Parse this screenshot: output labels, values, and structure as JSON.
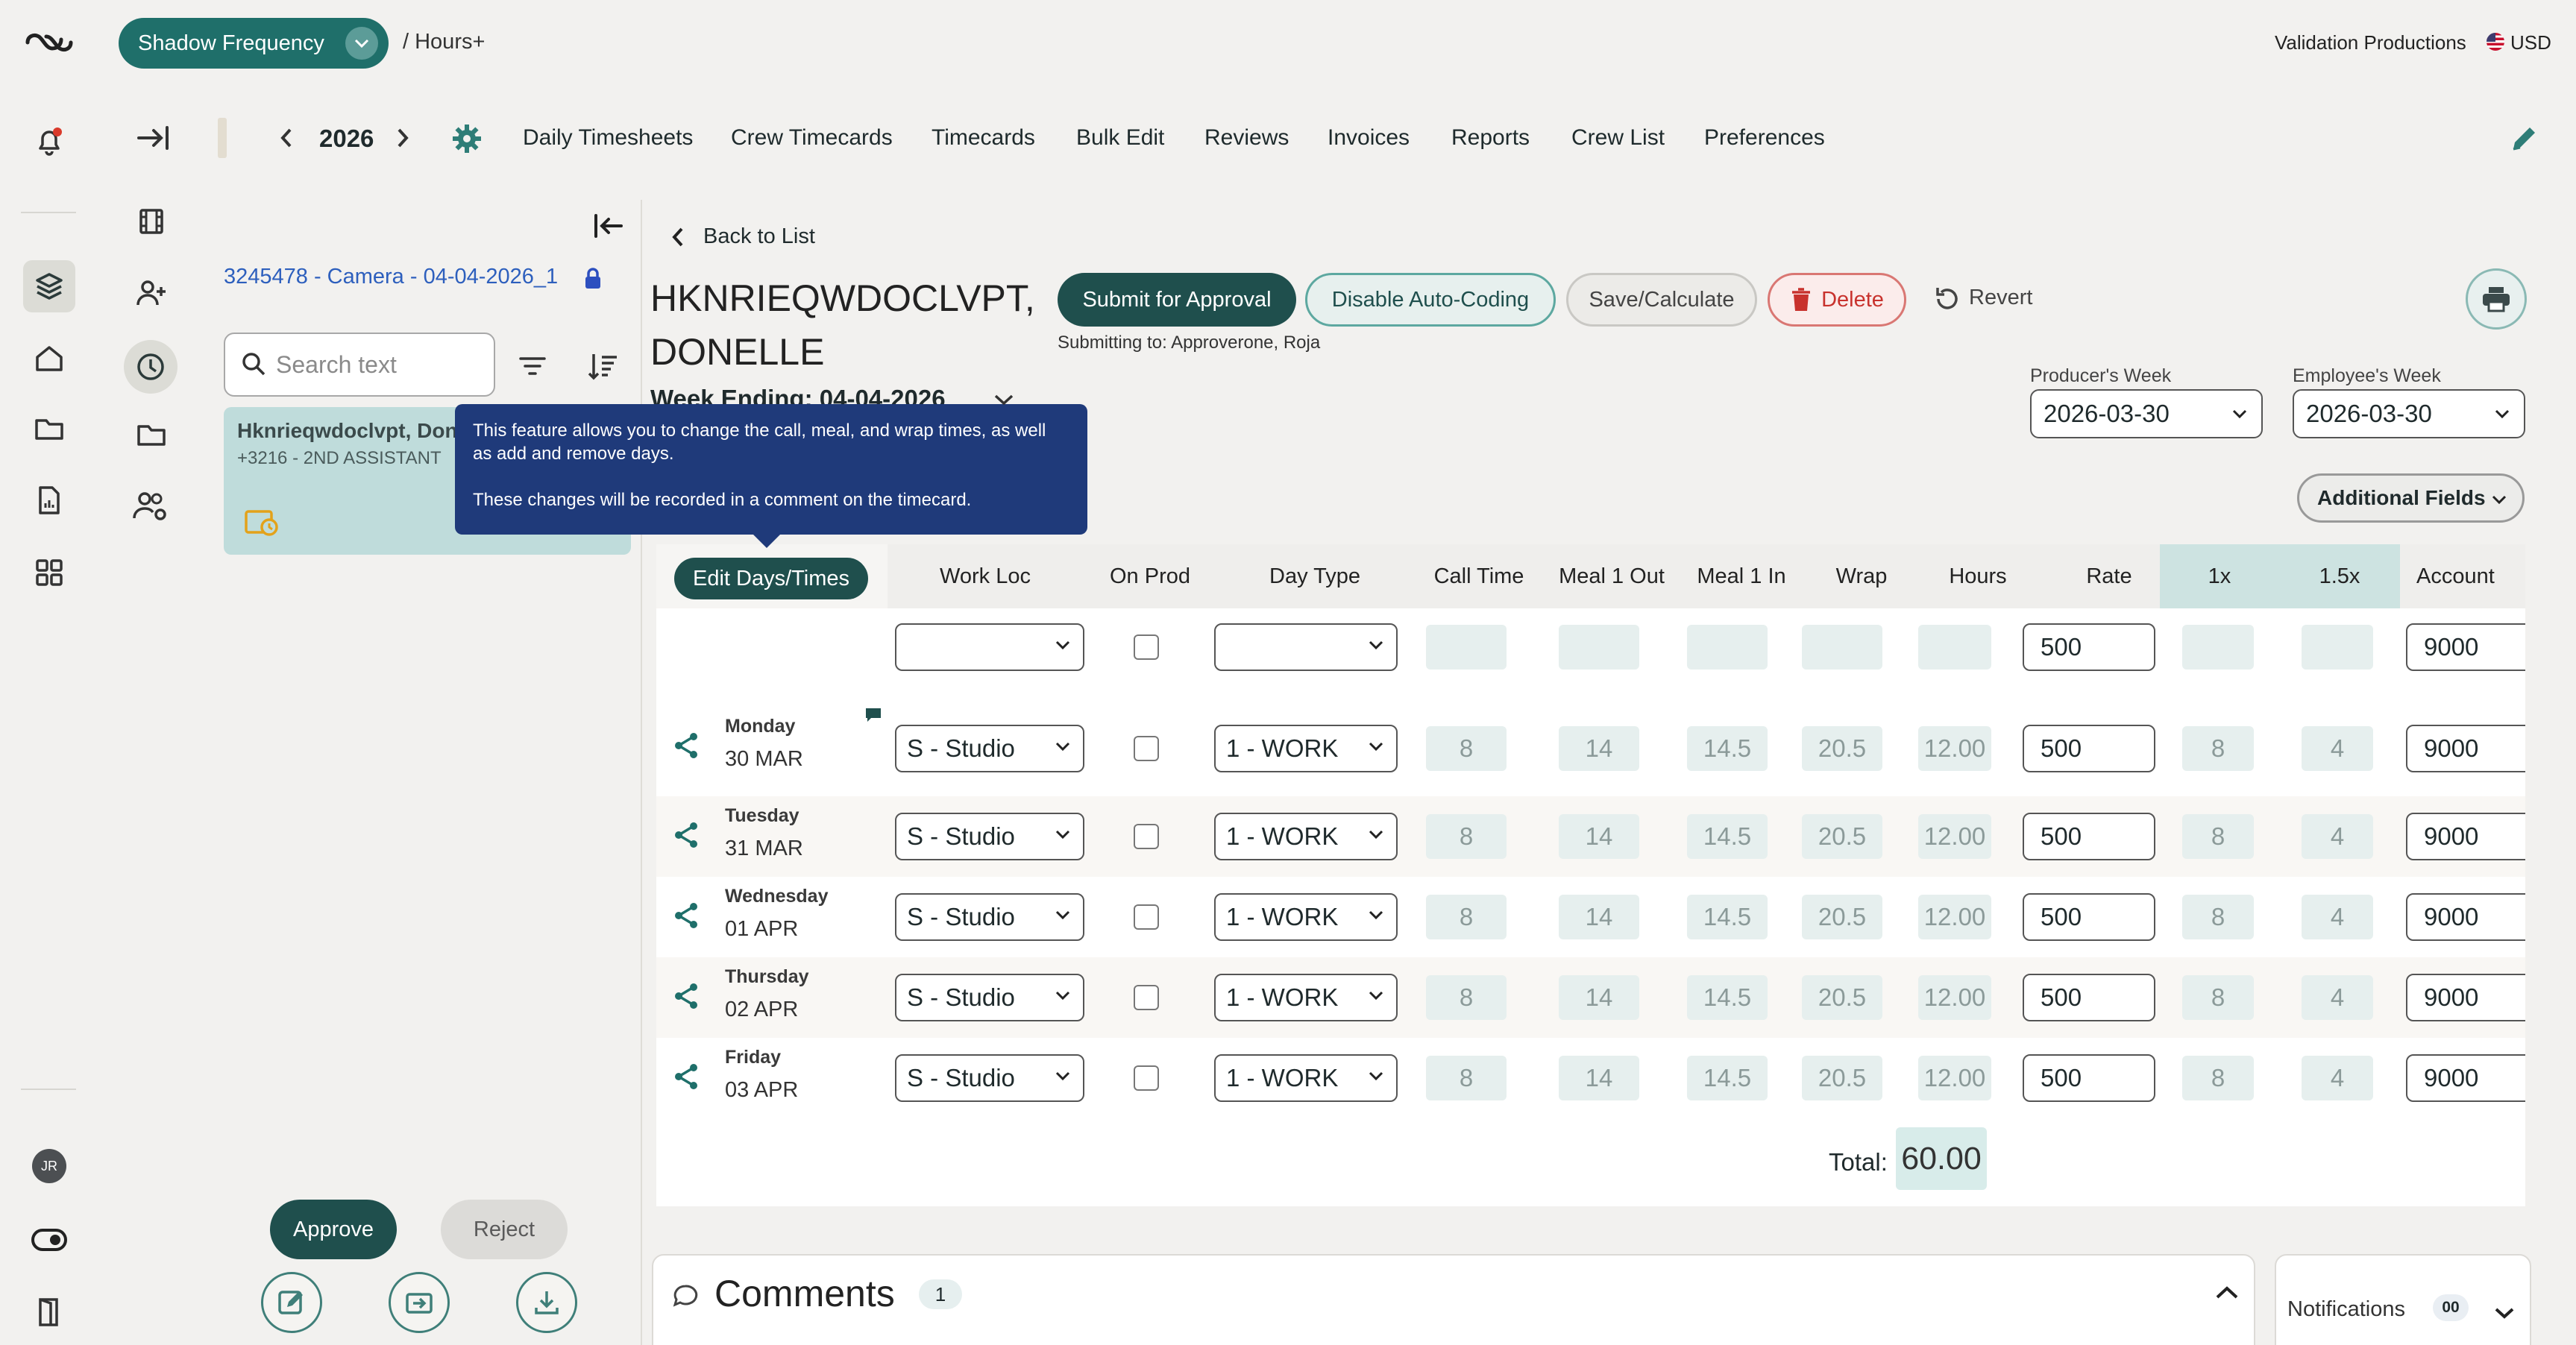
{
  "header": {
    "project": "Shadow Frequency",
    "breadcrumb": "/ Hours+",
    "company": "Validation Productions",
    "currency": "USD"
  },
  "nav": {
    "year": "2026",
    "links": [
      "Daily Timesheets",
      "Crew Timecards",
      "Timecards",
      "Bulk Edit",
      "Reviews",
      "Invoices",
      "Reports",
      "Crew List",
      "Preferences"
    ]
  },
  "sidebar": {
    "timecard_link": "3245478 - Camera - 04-04-2026_1",
    "search_placeholder": "Search text",
    "crew_name": "Hknrieqwdoclvpt, Don",
    "crew_sub": "+3216 - 2ND ASSISTANT",
    "approve_label": "Approve",
    "reject_label": "Reject",
    "avatar_initials": "JR"
  },
  "main": {
    "back_label": "Back to List",
    "employee_name_line1": "HKNRIEQWDOCLVPT,",
    "employee_name_line2": "DONELLE",
    "week_ending": "Week Ending: 04-04-2026",
    "submit_label": "Submit for Approval",
    "auto_coding_label": "Disable Auto-Coding",
    "save_label": "Save/Calculate",
    "delete_label": "Delete",
    "revert_label": "Revert",
    "submitting_to": "Submitting to:  Approverone, Roja",
    "producers_week_label": "Producer's Week",
    "producers_week_value": "2026-03-30",
    "employees_week_label": "Employee's Week",
    "employees_week_value": "2026-03-30",
    "additional_fields_label": "Additional Fields"
  },
  "tooltip": {
    "line1": "This feature allows you to change the call, meal, and wrap times, as well as add and remove days.",
    "line2": "These changes will be recorded in a comment on the timecard."
  },
  "grid": {
    "edit_label": "Edit Days/Times",
    "columns": [
      "Work Loc",
      "On Prod",
      "Day Type",
      "Call Time",
      "Meal 1 Out",
      "Meal 1 In",
      "Wrap",
      "Hours",
      "Rate",
      "1x",
      "1.5x",
      "Account"
    ],
    "template_row": {
      "rate": "500",
      "account": "9000"
    },
    "rows": [
      {
        "day": "Monday",
        "date": "30 MAR",
        "work_loc": "S - Studio",
        "day_type": "1 - WORK",
        "call": "8",
        "meal_out": "14",
        "meal_in": "14.5",
        "wrap": "20.5",
        "hours": "12.00",
        "rate": "500",
        "x1": "8",
        "x15": "4",
        "account": "9000"
      },
      {
        "day": "Tuesday",
        "date": "31 MAR",
        "work_loc": "S - Studio",
        "day_type": "1 - WORK",
        "call": "8",
        "meal_out": "14",
        "meal_in": "14.5",
        "wrap": "20.5",
        "hours": "12.00",
        "rate": "500",
        "x1": "8",
        "x15": "4",
        "account": "9000"
      },
      {
        "day": "Wednesday",
        "date": "01 APR",
        "work_loc": "S - Studio",
        "day_type": "1 - WORK",
        "call": "8",
        "meal_out": "14",
        "meal_in": "14.5",
        "wrap": "20.5",
        "hours": "12.00",
        "rate": "500",
        "x1": "8",
        "x15": "4",
        "account": "9000"
      },
      {
        "day": "Thursday",
        "date": "02 APR",
        "work_loc": "S - Studio",
        "day_type": "1 - WORK",
        "call": "8",
        "meal_out": "14",
        "meal_in": "14.5",
        "wrap": "20.5",
        "hours": "12.00",
        "rate": "500",
        "x1": "8",
        "x15": "4",
        "account": "9000"
      },
      {
        "day": "Friday",
        "date": "03 APR",
        "work_loc": "S - Studio",
        "day_type": "1 - WORK",
        "call": "8",
        "meal_out": "14",
        "meal_in": "14.5",
        "wrap": "20.5",
        "hours": "12.00",
        "rate": "500",
        "x1": "8",
        "x15": "4",
        "account": "9000"
      }
    ],
    "total_label": "Total:",
    "total_value": "60.00"
  },
  "comments": {
    "title": "Comments",
    "count": "1"
  },
  "notifications": {
    "title": "Notifications",
    "count": "00"
  },
  "icons": [
    "logo-icon",
    "bell-icon",
    "layers-icon",
    "home-icon",
    "folder-icon",
    "report-icon",
    "grid-icon",
    "toggle-icon",
    "door-icon",
    "collapse-icon",
    "film-icon",
    "add-user-icon",
    "clock-icon",
    "team-icon",
    "gear-icon",
    "pencil-icon",
    "filter-icon",
    "sort-icon",
    "lock-icon",
    "search-icon",
    "print-icon",
    "trash-icon",
    "revert-icon",
    "share-icon",
    "comment-icon"
  ],
  "colors": {
    "primary": "#1f4f4d",
    "teal": "#1f6f6a",
    "danger": "#c8322d",
    "tooltip": "#1f3a7a",
    "link": "#2d5fbd"
  }
}
